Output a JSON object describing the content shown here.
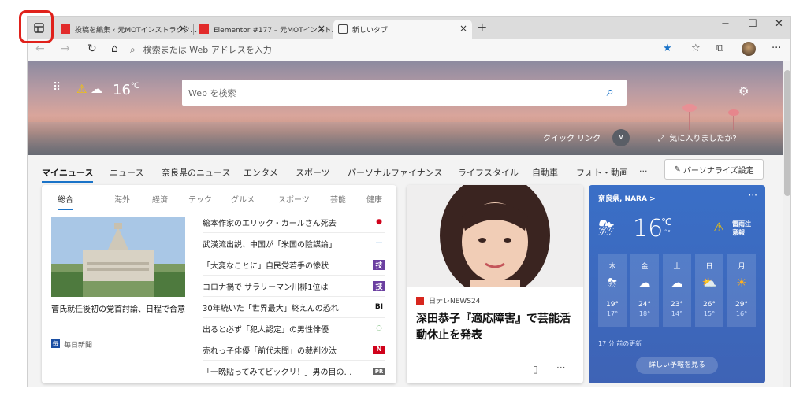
{
  "tabs": [
    {
      "title": "投稿を編集 ‹ 元MOTインストラクタ…",
      "close": "×"
    },
    {
      "title": "Elementor #177 – 元MOTインスト…",
      "close": "×"
    },
    {
      "title": "新しいタブ",
      "close": "×"
    }
  ],
  "new_tab": "+",
  "window_controls": {
    "minimize": "−",
    "maximize": "☐",
    "close": "✕"
  },
  "address": {
    "placeholder": "検索または Web アドレスを入力"
  },
  "hero": {
    "temperature": "16",
    "unit": "℃",
    "search_placeholder": "Web を検索",
    "quick_links": "クイック リンク",
    "like_prompt": "気に入りましたか?"
  },
  "categories": [
    "マイニュース",
    "ニュース",
    "奈良県のニュース",
    "エンタメ",
    "スポーツ",
    "パーソナルファイナンス",
    "ライフスタイル",
    "自動車",
    "フォト・動画",
    "···"
  ],
  "personalize": "パーソナライズ設定",
  "news": {
    "tabs": [
      "総合",
      "海外",
      "経済",
      "テック",
      "グルメ",
      "スポーツ",
      "芸能",
      "健康"
    ],
    "lead_title": "菅氏就任後初の党首討論、日程で合意",
    "lead_source": "毎日新聞",
    "lead_source_badge": "毎",
    "headlines": [
      {
        "text": "絵本作家のエリック・カールさん死去",
        "icon": "●",
        "color": "#d0021b"
      },
      {
        "text": "武漢流出説、中国が「米国の陰謀論」",
        "icon": "—",
        "color": "#1a73c8"
      },
      {
        "text": "「大変なことに」自民党若手の惨状",
        "icon": "技",
        "color": "#6b3fa0"
      },
      {
        "text": "コロナ禍で サラリーマン川柳1位は",
        "icon": "技",
        "color": "#6b3fa0"
      },
      {
        "text": "30年続いた「世界最大」終えんの恐れ",
        "icon": "BI",
        "color": "#111111"
      },
      {
        "text": "出ると必ず「犯人認定」の男性俳優",
        "icon": "◌",
        "color": "#3a9a3a"
      },
      {
        "text": "売れっ子俳優「前代未聞」の裁判沙汰",
        "icon": "N",
        "color": "#d0021b"
      },
      {
        "text": "「一晩貼ってみてビックリ！」男の目の…",
        "icon": "PR",
        "color": "#666666"
      }
    ]
  },
  "feature": {
    "source": "日テレNEWS24",
    "title": "深田恭子『適応障害』で芸能活動休止を発表",
    "more": "···"
  },
  "weather": {
    "location": "奈良県, NARA  >",
    "more": "···",
    "temperature": "16",
    "unit_c": "℃",
    "unit_f": "°F",
    "alert": "雷雨注意報",
    "forecast": [
      {
        "day": "木",
        "icon": "⛈",
        "high": "19°",
        "low": "17°"
      },
      {
        "day": "金",
        "icon": "☁",
        "high": "24°",
        "low": "18°"
      },
      {
        "day": "土",
        "icon": "☁",
        "high": "23°",
        "low": "14°"
      },
      {
        "day": "日",
        "icon": "⛅",
        "high": "26°",
        "low": "15°"
      },
      {
        "day": "月",
        "icon": "☀",
        "high": "29°",
        "low": "16°"
      }
    ],
    "updated": "17 分 前の更新",
    "button": "詳しい予報を見る"
  }
}
